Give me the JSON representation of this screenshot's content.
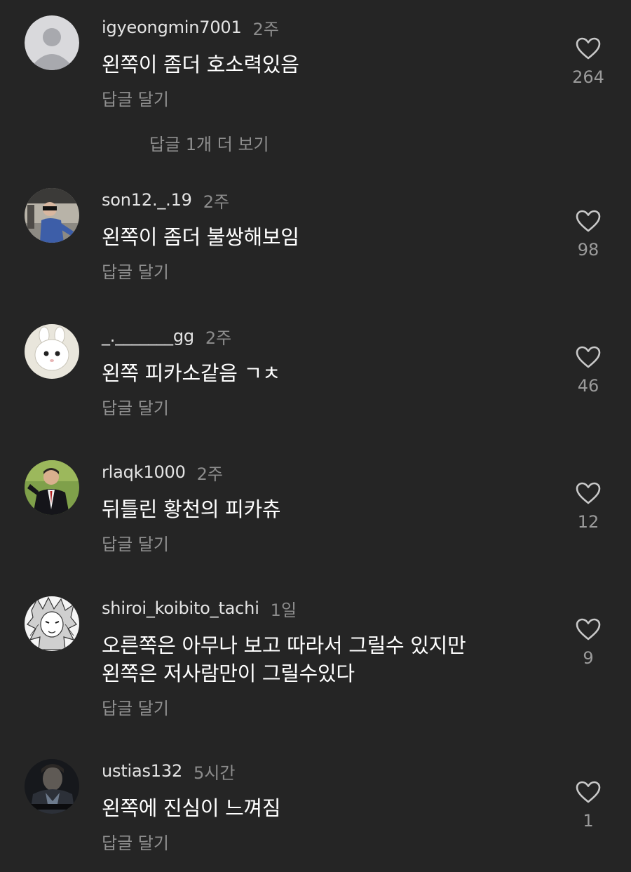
{
  "comments": [
    {
      "username": "igyeongmin7001",
      "time": "2주",
      "text": "왼쪽이 좀더 호소력있음",
      "text2": "",
      "reply_label": "답글 달기",
      "likes": "264"
    },
    {
      "username": "son12._.19",
      "time": "2주",
      "text": "왼쪽이 좀더 불쌍해보임",
      "text2": "",
      "reply_label": "답글 달기",
      "likes": "98"
    },
    {
      "username": "_._______gg",
      "time": "2주",
      "text": "왼쪽 피카소같음 ㄱㅊ",
      "text2": "",
      "reply_label": "답글 달기",
      "likes": "46"
    },
    {
      "username": "rlaqk1000",
      "time": "2주",
      "text": "뒤틀린 황천의 피카츄",
      "text2": "",
      "reply_label": "답글 달기",
      "likes": "12"
    },
    {
      "username": "shiroi_koibito_tachi",
      "time": "1일",
      "text": "오른쪽은 아무나 보고 따라서 그릴수 있지만",
      "text2": "왼쪽은 저사람만이 그릴수있다",
      "reply_label": "답글 달기",
      "likes": "9"
    },
    {
      "username": "ustias132",
      "time": "5시간",
      "text": "왼쪽에 진심이 느껴짐",
      "text2": "",
      "reply_label": "답글 달기",
      "likes": "1"
    }
  ],
  "view_more_replies": "답글 1개 더 보기",
  "icons": {
    "like": "heart-outline-icon",
    "default_avatar": "default-user-avatar-icon"
  },
  "colors": {
    "background": "#252525",
    "text": "#ffffff",
    "secondary": "#8f8f8f"
  }
}
